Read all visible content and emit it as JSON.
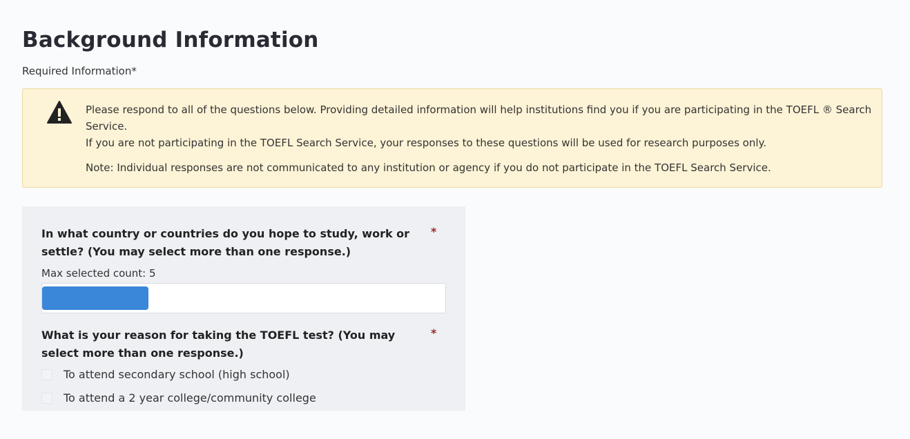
{
  "page": {
    "title": "Background Information",
    "required_label": "Required Information",
    "required_star": "*"
  },
  "alert": {
    "icon": "warning-icon",
    "line1": "Please respond to all of the questions below. Providing detailed information will help institutions find you if you are participating in the TOEFL ® Search Service.",
    "line2": "If you are not participating in the TOEFL Search Service, your responses to these questions will be used for research purposes only.",
    "note": "Note: Individual responses are not communicated to any institution or agency if you do not participate in the TOEFL Search Service."
  },
  "questions": [
    {
      "text": "In what country or countries do you hope to study, work or settle? (You may select more than one response.)",
      "required_marker": "*",
      "max_label": "Max selected count: 5"
    },
    {
      "text": "What is your reason for taking the TOEFL test? (You may select more than one response.)",
      "required_marker": "*",
      "options": [
        "To attend secondary school (high school)",
        "To attend a 2 year college/community college"
      ]
    }
  ],
  "colors": {
    "alert_bg": "#fdf3d6",
    "chip": "#3a86d8",
    "required_marker": "#9a2a2a"
  }
}
